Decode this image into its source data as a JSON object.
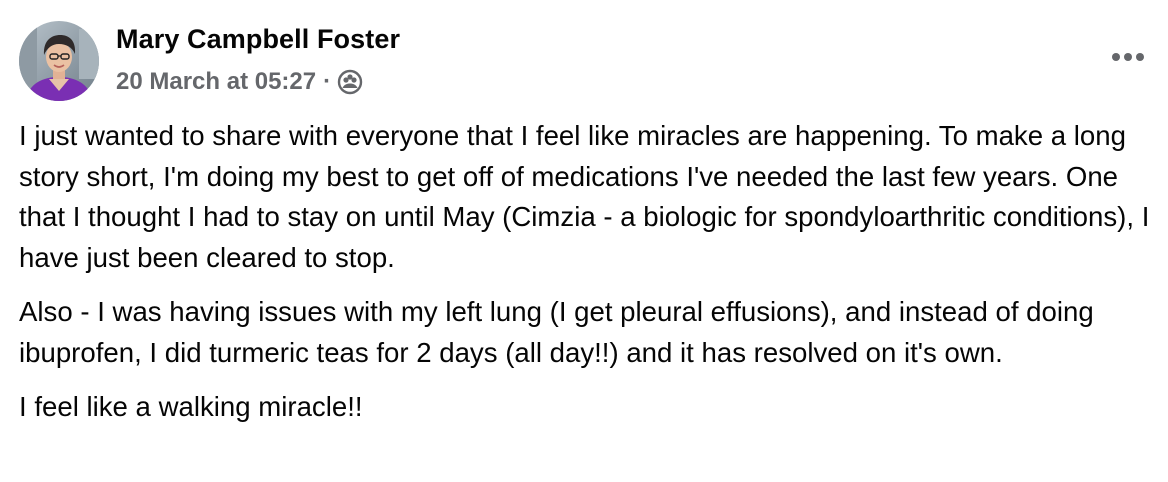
{
  "post": {
    "author": {
      "name": "Mary Campbell Foster",
      "avatar_icon": "profile-photo"
    },
    "timestamp": "20 March at 05:27",
    "separator": "·",
    "audience_icon": "friends-group-icon",
    "more_icon": "more-options-icon",
    "paragraphs": [
      "I just wanted to share with everyone that I feel like miracles are happening. To make a long story short, I'm doing my best to get off of medications I've needed the last few years. One that I thought I had to stay on until May (Cimzia - a biologic for spondyloarthritic conditions), I have just been cleared to stop.",
      "Also - I was having issues with my left lung (I get pleural effusions), and instead of doing ibuprofen, I did turmeric teas for 2 days (all day!!) and it has resolved on it's own.",
      "I feel like a walking miracle!!"
    ]
  },
  "colors": {
    "primary_text": "#050505",
    "secondary_text": "#65676b",
    "background": "#ffffff"
  }
}
